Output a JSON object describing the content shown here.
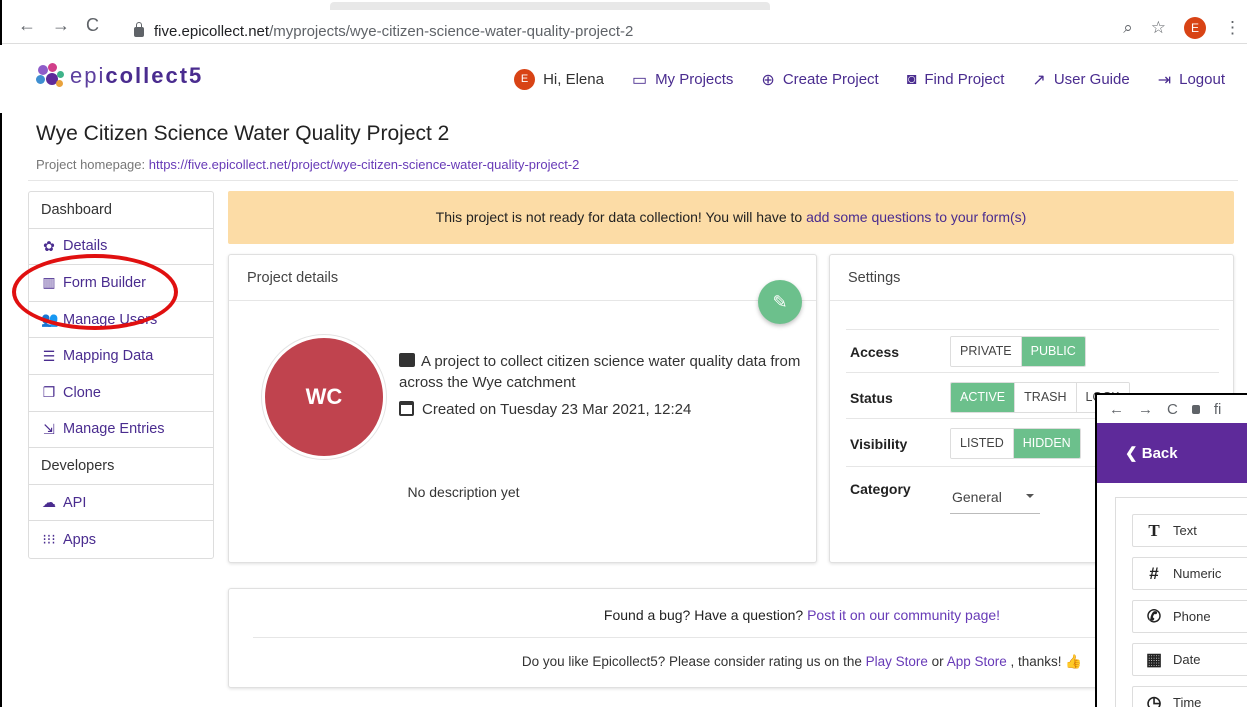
{
  "browser": {
    "url_host": "five.epicollect.net",
    "url_path": "/myprojects/wye-citizen-science-water-quality-project-2",
    "profile_initial": "E"
  },
  "header": {
    "logo_prefix": "epi",
    "logo_bold": "collect5",
    "user_initial": "E",
    "greeting": "Hi, Elena",
    "nav": {
      "my_projects": "My Projects",
      "create_project": "Create Project",
      "find_project": "Find Project",
      "user_guide": "User Guide",
      "logout": "Logout"
    }
  },
  "project": {
    "title": "Wye Citizen Science Water Quality Project 2",
    "homepage_label": "Project homepage:",
    "homepage_url": "https://five.epicollect.net/project/wye-citizen-science-water-quality-project-2",
    "initials": "WC",
    "description": "A project to collect citizen science water quality data from across the Wye catchment",
    "created": "Created on Tuesday 23 Mar 2021, 12:24",
    "no_description": "No description yet"
  },
  "sidebar": {
    "dashboard": "Dashboard",
    "items": [
      {
        "label": "Details",
        "icon": "gear-icon"
      },
      {
        "label": "Form Builder",
        "icon": "form-icon"
      },
      {
        "label": "Manage Users",
        "icon": "users-icon"
      },
      {
        "label": "Mapping Data",
        "icon": "list-icon"
      },
      {
        "label": "Clone",
        "icon": "clone-icon"
      },
      {
        "label": "Manage Entries",
        "icon": "entries-icon"
      }
    ],
    "developers": "Developers",
    "dev_items": [
      {
        "label": "API",
        "icon": "cloud-icon"
      },
      {
        "label": "Apps",
        "icon": "apps-icon"
      }
    ]
  },
  "warning": {
    "text": "This project is not ready for data collection! You will have to",
    "link": "add some questions to your form(s)"
  },
  "details_card": {
    "title": "Project details"
  },
  "settings": {
    "title": "Settings",
    "access_label": "Access",
    "access_options": [
      "PRIVATE",
      "PUBLIC"
    ],
    "access_selected": "PUBLIC",
    "status_label": "Status",
    "status_options": [
      "ACTIVE",
      "TRASH",
      "LOCK"
    ],
    "status_selected": "ACTIVE",
    "visibility_label": "Visibility",
    "visibility_options": [
      "LISTED",
      "HIDDEN"
    ],
    "visibility_selected": "HIDDEN",
    "category_label": "Category",
    "category_value": "General"
  },
  "footer": {
    "question": "Found a bug? Have a question?",
    "community_link": "Post it on our community page!",
    "rate_text": "Do you like Epicollect5? Please consider rating us on the",
    "play_store": "Play Store",
    "or": "or",
    "app_store": "App Store",
    "thanks": ", thanks!"
  },
  "overlay": {
    "url_fragment": "fi",
    "back_label": "Back",
    "items": [
      {
        "label": "Text",
        "icon": "text-icon"
      },
      {
        "label": "Numeric",
        "icon": "hash-icon"
      },
      {
        "label": "Phone",
        "icon": "phone-icon"
      },
      {
        "label": "Date",
        "icon": "calendar-icon"
      },
      {
        "label": "Time",
        "icon": "clock-icon"
      }
    ]
  },
  "colors": {
    "brand_purple": "#4a2c8f",
    "accent_green": "#6cc08c",
    "warning_bg": "#fcdca6",
    "avatar_red": "#c0434e",
    "highlight_red": "#e01010"
  }
}
